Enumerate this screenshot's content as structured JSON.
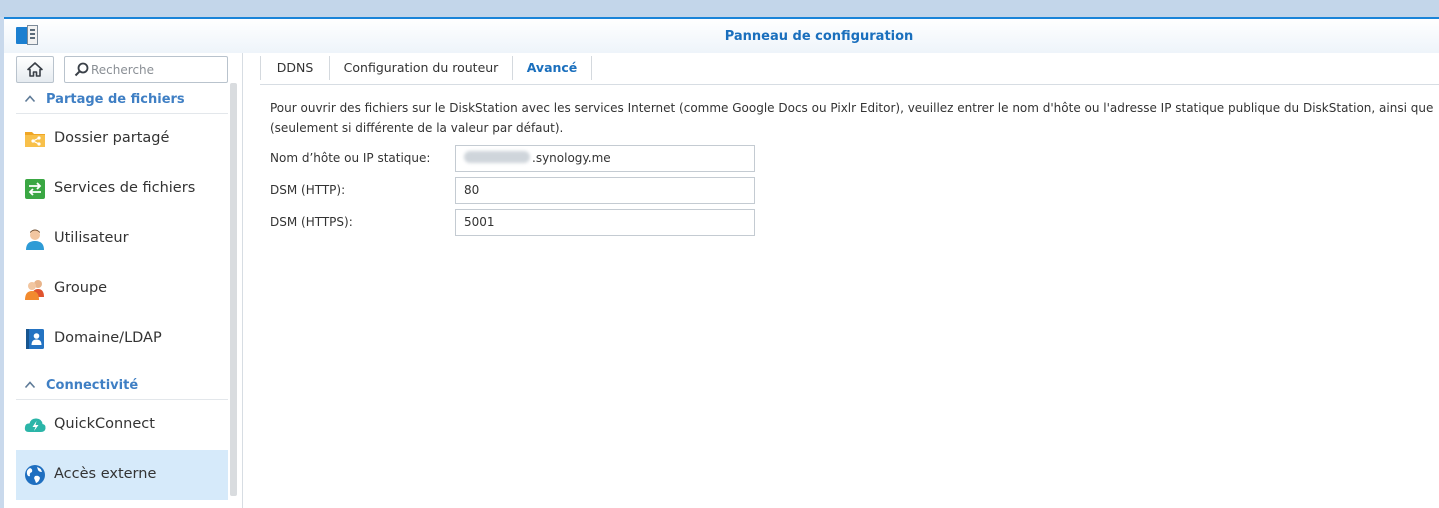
{
  "window": {
    "title": "Panneau de configuration"
  },
  "search": {
    "placeholder": "Recherche"
  },
  "sidebar": {
    "sections": [
      {
        "label": "Partage de fichiers"
      },
      {
        "label": "Connectivité"
      }
    ],
    "items": [
      {
        "label": "Dossier partagé",
        "icon": "shared-folder-icon"
      },
      {
        "label": "Services de fichiers",
        "icon": "file-services-icon"
      },
      {
        "label": "Utilisateur",
        "icon": "user-icon"
      },
      {
        "label": "Groupe",
        "icon": "group-icon"
      },
      {
        "label": "Domaine/LDAP",
        "icon": "domain-ldap-icon"
      },
      {
        "label": "QuickConnect",
        "icon": "quickconnect-icon"
      },
      {
        "label": "Accès externe",
        "icon": "globe-icon",
        "active": true
      }
    ]
  },
  "tabs": [
    {
      "label": "DDNS"
    },
    {
      "label": "Configuration du routeur"
    },
    {
      "label": "Avancé",
      "active": true
    }
  ],
  "main": {
    "description_line1": "Pour ouvrir des fichiers sur le DiskStation avec les services Internet (comme Google Docs ou Pixlr Editor), veuillez entrer le nom d'hôte ou l'adresse IP statique publique du DiskStation, ainsi que",
    "description_line2": "(seulement si différente de la valeur par défaut).",
    "fields": [
      {
        "label": "Nom d’hôte ou IP statique:",
        "value": ".synology.me"
      },
      {
        "label": "DSM (HTTP):",
        "value": "80"
      },
      {
        "label": "DSM (HTTPS):",
        "value": "5001"
      }
    ]
  },
  "colors": {
    "accent": "#1a6fbd",
    "active_item_bg": "#d6eafa",
    "window_border": "#1a84d8"
  }
}
